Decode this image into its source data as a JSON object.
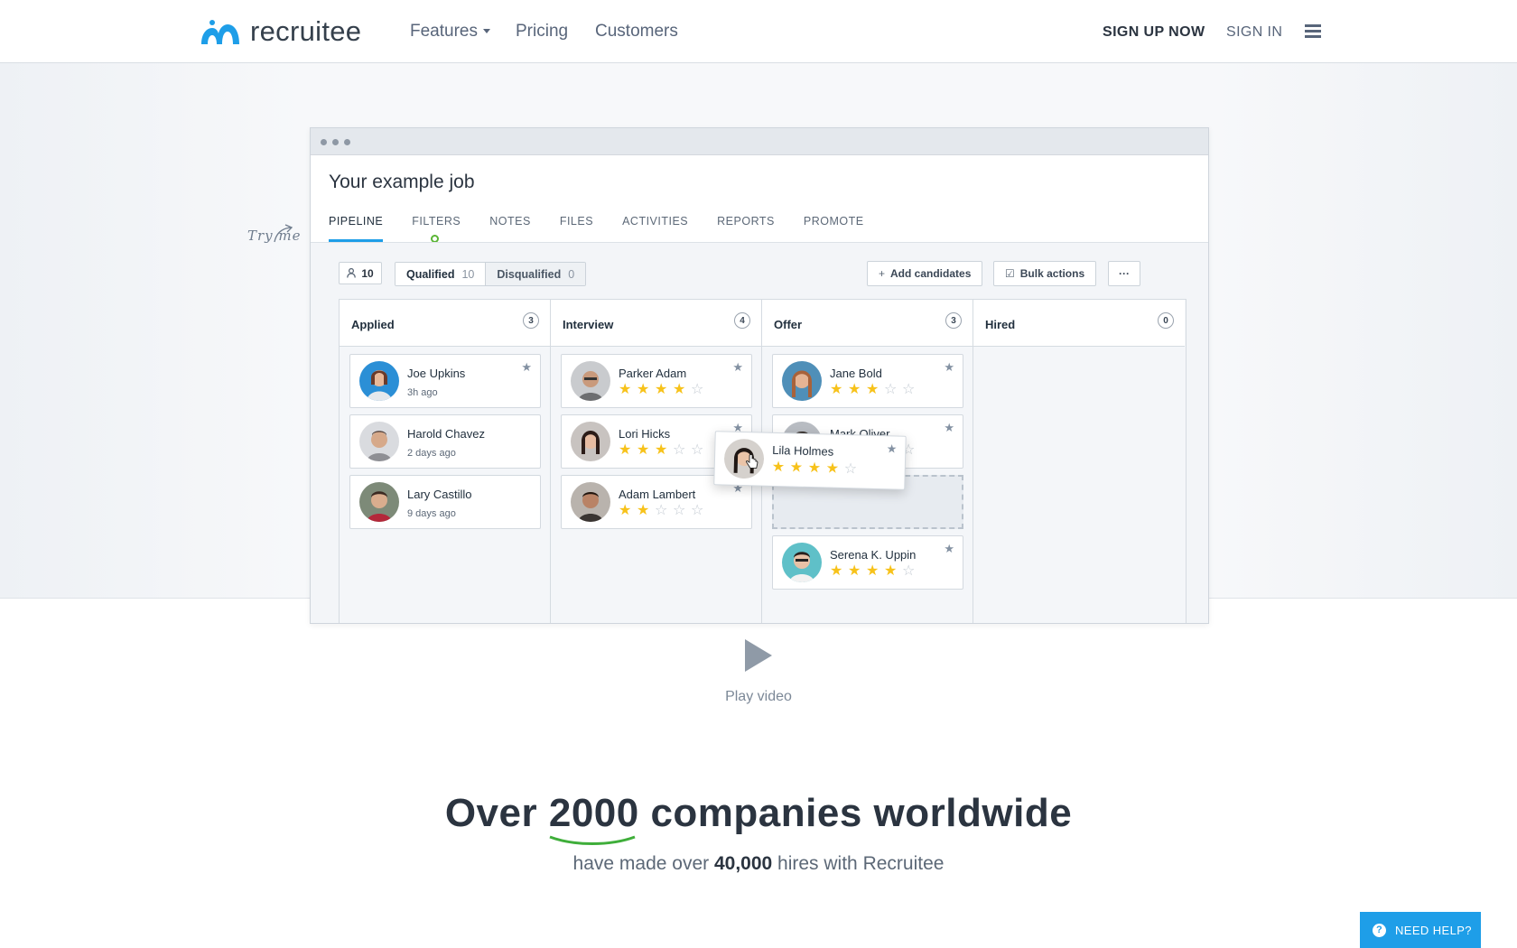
{
  "nav": {
    "brand": "recruitee",
    "features": "Features",
    "pricing": "Pricing",
    "customers": "Customers",
    "signup": "SIGN UP NOW",
    "signin": "SIGN IN"
  },
  "hint": "Try me",
  "job": {
    "title": "Your example job",
    "tabs": [
      "PIPELINE",
      "FILTERS",
      "NOTES",
      "FILES",
      "ACTIVITIES",
      "REPORTS",
      "PROMOTE"
    ],
    "total_count": "10",
    "qualified_label": "Qualified",
    "qualified_count": "10",
    "disqualified_label": "Disqualified",
    "disqualified_count": "0",
    "add_candidates": "Add candidates",
    "bulk_actions": "Bulk actions",
    "more": "···"
  },
  "columns": [
    {
      "title": "Applied",
      "count": "3"
    },
    {
      "title": "Interview",
      "count": "4"
    },
    {
      "title": "Offer",
      "count": "3"
    },
    {
      "title": "Hired",
      "count": "0"
    }
  ],
  "cards": {
    "applied": [
      {
        "name": "Joe Upkins",
        "sub": "3h ago"
      },
      {
        "name": "Harold Chavez",
        "sub": "2 days ago"
      },
      {
        "name": "Lary Castillo",
        "sub": "9 days ago"
      }
    ],
    "interview": [
      {
        "name": "Parker Adam",
        "rating": 4
      },
      {
        "name": "Lori Hicks",
        "rating": 3
      },
      {
        "name": "Adam Lambert",
        "rating": 2
      }
    ],
    "offer": [
      {
        "name": "Jane Bold",
        "rating": 3
      },
      {
        "name": "Mark Oliver",
        "rating": 4
      },
      {
        "name": "Serena K. Uppin",
        "rating": 4
      }
    ],
    "dragging": {
      "name": "Lila Holmes",
      "rating": 4
    }
  },
  "play_label": "Play video",
  "headline": {
    "pre": "Over ",
    "number": "2000",
    "post": " companies worldwide"
  },
  "subline": {
    "pre": "have made over ",
    "number": "40,000",
    "post": " hires with Recruitee"
  },
  "help": "NEED HELP?",
  "colors": {
    "accent": "#1e9ee8",
    "star": "#f7c21a",
    "green": "#5ab535"
  }
}
